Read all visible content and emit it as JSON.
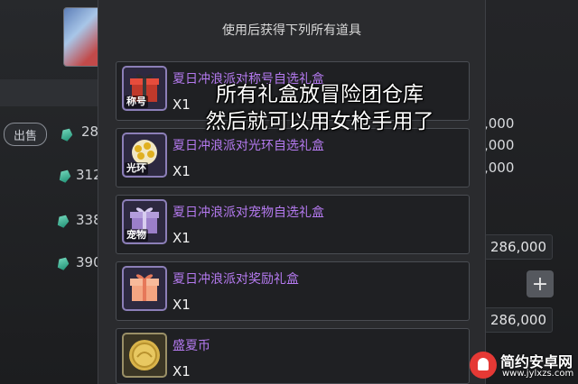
{
  "panel": {
    "title": "使用后获得下列所有道具"
  },
  "items": [
    {
      "name": "夏日冲浪派对称号自选礼盒",
      "qty": "X1",
      "tag": "称号",
      "icon": "red-gift-box-icon"
    },
    {
      "name": "夏日冲浪派对光环自选礼盒",
      "qty": "X1",
      "tag": "光环",
      "icon": "gold-gift-box-icon"
    },
    {
      "name": "夏日冲浪派对宠物自选礼盒",
      "qty": "X1",
      "tag": "宠物",
      "icon": "purple-gift-box-icon"
    },
    {
      "name": "夏日冲浪派对奖励礼盒",
      "qty": "X1",
      "tag": "",
      "icon": "orange-gift-box-icon"
    },
    {
      "name": "盛夏币",
      "qty": "X1",
      "tag": "",
      "icon": "gold-coin-icon"
    }
  ],
  "overlay": {
    "line1": "所有礼盒放冒险团仓库",
    "line2": "然后就可以用女枪手用了"
  },
  "background": {
    "sell_label": "出售",
    "left_prices": [
      "28",
      "312",
      "338",
      "390"
    ],
    "right_prices": [
      ",000",
      ",000",
      ",000"
    ],
    "right_box1": "286,000",
    "right_box2": "286,000",
    "plus_label": "+"
  },
  "watermark": {
    "brand": "简约安卓网",
    "url": "www.jylxzs.com"
  }
}
